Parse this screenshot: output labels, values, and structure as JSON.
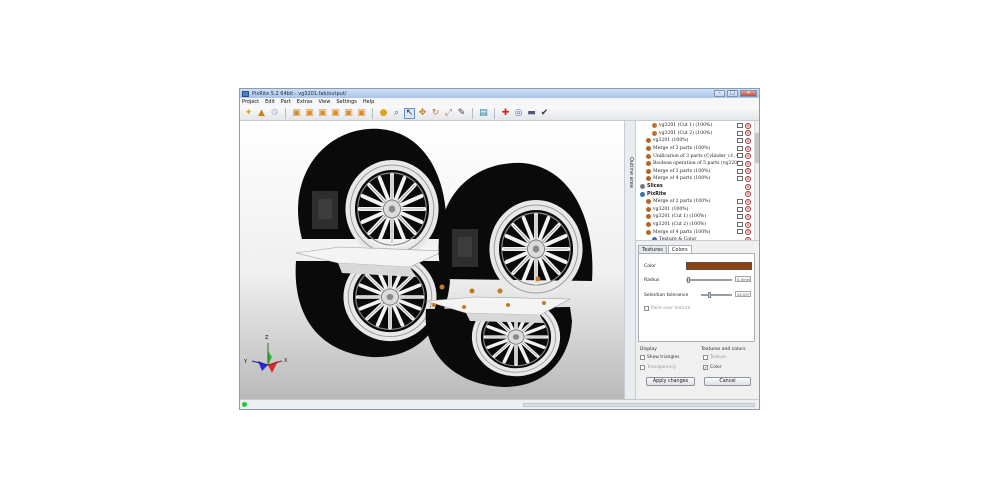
{
  "app": {
    "title": "PixRite 5.2 64bit - vg3201.fab/output/",
    "window_controls": {
      "minimize": "–",
      "maximize": "□",
      "close": "✕"
    }
  },
  "menu": [
    "Project",
    "Edit",
    "Part",
    "Extras",
    "View",
    "Settings",
    "Help"
  ],
  "toolbar": {
    "icons": [
      "new-project-icon",
      "open-icon",
      "import-icon",
      "sep",
      "view-top-icon",
      "view-front-icon",
      "view-left-icon",
      "view-right-icon",
      "view-back-icon",
      "view-iso-icon",
      "sep",
      "sun-light-icon",
      "zoom-icon",
      "select-cursor-icon",
      "move-icon",
      "rotate-icon",
      "scale-icon",
      "paint-brush-icon",
      "sep",
      "layers-icon",
      "sep",
      "add-red-cross-icon",
      "measure-icon",
      "ruler-icon",
      "check-icon"
    ],
    "glyphs": {
      "new-project-icon": "✦",
      "open-icon": "▲",
      "import-icon": "♲",
      "view-top-icon": "▣",
      "view-front-icon": "▣",
      "view-left-icon": "▣",
      "view-right-icon": "▣",
      "view-back-icon": "▣",
      "view-iso-icon": "▣",
      "sun-light-icon": "●",
      "zoom-icon": "⌕",
      "select-cursor-icon": "↖",
      "move-icon": "✥",
      "rotate-icon": "↻",
      "scale-icon": "⤢",
      "paint-brush-icon": "✎",
      "layers-icon": "▤",
      "add-red-cross-icon": "✚",
      "measure-icon": "◎",
      "ruler-icon": "▬",
      "check-icon": "✔"
    },
    "colors": {
      "new-project-icon": "#d9a319",
      "open-icon": "#c8851c",
      "import-icon": "#4a6ea8",
      "view-top-icon": "#d98a2a",
      "view-front-icon": "#d98a2a",
      "view-left-icon": "#d98a2a",
      "view-right-icon": "#d98a2a",
      "view-back-icon": "#d98a2a",
      "view-iso-icon": "#d98a2a",
      "sun-light-icon": "#e0a020",
      "zoom-icon": "#3a6fb0",
      "select-cursor-icon": "#333333",
      "move-icon": "#c07a22",
      "rotate-icon": "#c07a22",
      "scale-icon": "#c07a22",
      "paint-brush-icon": "#444444",
      "layers-icon": "#2f7f9e",
      "add-red-cross-icon": "#d62020",
      "measure-icon": "#3a6fb0",
      "ruler-icon": "#555577",
      "check-icon": "#333333"
    },
    "active": "select-cursor-icon"
  },
  "viewport": {
    "axes": {
      "x": "X",
      "y": "Y",
      "z": "Z"
    }
  },
  "outline_tab": {
    "label": "Outline area"
  },
  "tree": {
    "rows": [
      {
        "label": "vg3201 (Cut 1) (100%)",
        "indent": 2,
        "icon_color": "#c0702a",
        "eye": true
      },
      {
        "label": "vg3201 (Cut 2) (100%)",
        "indent": 2,
        "icon_color": "#c0702a",
        "eye": true
      },
      {
        "label": "vg3201 (100%)",
        "indent": 1,
        "icon_color": "#b0682a",
        "eye": true
      },
      {
        "label": "Merge of 2 parts (100%)",
        "indent": 1,
        "icon_color": "#b0682a",
        "eye": true
      },
      {
        "label": "Unification of 3 parts (Cylinder_c1, Cy...",
        "indent": 1,
        "icon_color": "#b0682a",
        "eye": true
      },
      {
        "label": "Boolean operation of 5 parts (vg3201)",
        "indent": 1,
        "icon_color": "#b0682a",
        "eye": true
      },
      {
        "label": "Merge of 2 parts (100%)",
        "indent": 1,
        "icon_color": "#b0682a",
        "eye": true
      },
      {
        "label": "Merge of 4 parts (100%)",
        "indent": 1,
        "icon_color": "#b0682a",
        "eye": true
      },
      {
        "label": "Slices",
        "indent": 0,
        "icon_color": "#7a7a7a",
        "eye": false,
        "group": true
      },
      {
        "label": "PixRite",
        "indent": 0,
        "icon_color": "#3a6fb0",
        "eye": false,
        "group": true
      },
      {
        "label": "Merge of 2 parts (100%)",
        "indent": 1,
        "icon_color": "#b0682a",
        "eye": true
      },
      {
        "label": "vg3201 (100%)",
        "indent": 1,
        "icon_color": "#b0682a",
        "eye": true
      },
      {
        "label": "vg3201 (Cut 1) (100%)",
        "indent": 1,
        "icon_color": "#b0682a",
        "eye": true
      },
      {
        "label": "vg3201 (Cut 2) (100%)",
        "indent": 1,
        "icon_color": "#b0682a",
        "eye": true
      },
      {
        "label": "Merge of 4 parts (100%)",
        "indent": 1,
        "icon_color": "#b0682a",
        "eye": true
      },
      {
        "label": "Texture & Color",
        "indent": 2,
        "icon_color": "#4a6ea8",
        "eye": false
      }
    ]
  },
  "tabs": {
    "textures": "Textures",
    "colors": "Colors",
    "active": "colors"
  },
  "colors_panel": {
    "color_label": "Color",
    "color_value": "#8b4210",
    "radius_label": "Radius",
    "radius_value": "0.5mm",
    "radius_level": 0.02,
    "tolerance_label": "Selection tolerance",
    "tolerance_value": "44.00°",
    "tolerance_level": 0.22,
    "paint_over_texture": "Paint over texture"
  },
  "display": {
    "heading": "Display",
    "show_triangles": "Show triangles",
    "transparency": "Transparency"
  },
  "textures_colors": {
    "heading": "Textures and colors",
    "texture": "Texture",
    "color": "Color"
  },
  "buttons": {
    "apply": "Apply changes",
    "cancel": "Cancel"
  }
}
